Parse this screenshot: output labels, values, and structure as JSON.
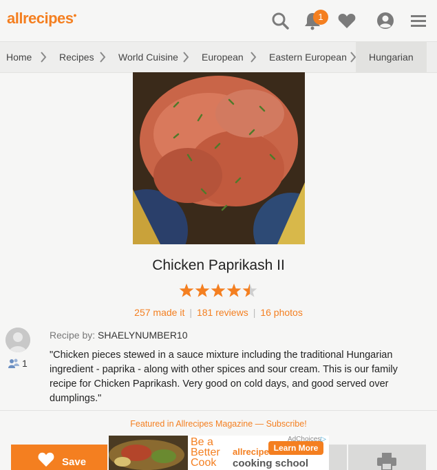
{
  "header": {
    "logo": "allrecipes",
    "notification_count": "1",
    "icons": [
      "search-icon",
      "bell-icon",
      "heart-icon",
      "profile-icon",
      "menu-icon"
    ],
    "brand_color": "#f47f20"
  },
  "breadcrumb": [
    "Home",
    "Recipes",
    "World Cuisine",
    "European",
    "Eastern European",
    "Hungarian"
  ],
  "recipe": {
    "title": "Chicken Paprikash II",
    "rating": 4.5,
    "made_it": "257 made it",
    "reviews": "181 reviews",
    "photos": "16 photos",
    "author_label": "Recipe by:",
    "author": "SHAELYNUMBER10",
    "made_count": "1",
    "description": "\"Chicken pieces stewed in a sauce mixture including the traditional Hungarian ingredient - paprika - along with other spices and sour cream. This is our family recipe for Chicken Paprikash. Very good on cold days, and good served over dumplings.\""
  },
  "featured": "Featured in Allrecipes Magazine — Subscribe!",
  "actions": {
    "save_label": "Save"
  },
  "ad": {
    "adchoices": "AdChoices",
    "tagline_1": "Be a",
    "tagline_2": "Better",
    "tagline_3": "Cook",
    "brand": "allrecipes",
    "button": "Learn More",
    "product": "cooking school"
  }
}
